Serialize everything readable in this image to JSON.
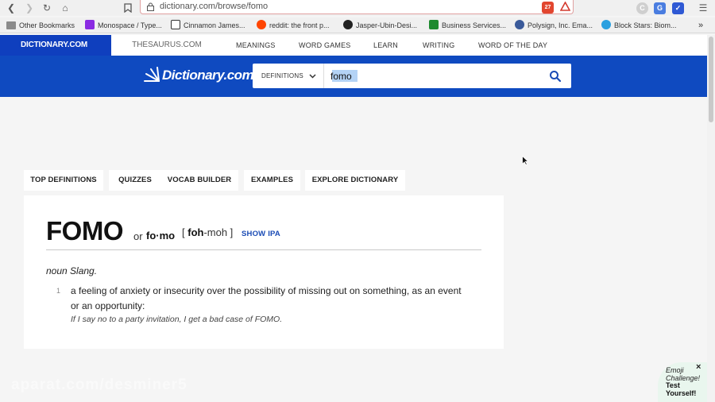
{
  "browser": {
    "url": "dictionary.com/browse/fomo",
    "extension_badge": "27",
    "bookmarks": [
      {
        "label": "Other Bookmarks",
        "icon": "folder-icon",
        "color": "#7b7b7b"
      },
      {
        "label": "Monospace / Type...",
        "icon": "monospace-favicon",
        "color": "#8a2be2"
      },
      {
        "label": "Cinnamon James...",
        "icon": "cinnamon-favicon",
        "color": "#333333"
      },
      {
        "label": "reddit: the front p...",
        "icon": "reddit-favicon",
        "color": "#ff4500"
      },
      {
        "label": "Jasper-Ubin-Desi...",
        "icon": "github-favicon",
        "color": "#222222"
      },
      {
        "label": "Business Services...",
        "icon": "business-favicon",
        "color": "#1e8a2f"
      },
      {
        "label": "Polysign, Inc. Ema...",
        "icon": "polysign-favicon",
        "color": "#3a5a9a"
      },
      {
        "label": "Block Stars: Biom...",
        "icon": "blockstars-favicon",
        "color": "#2aa0e0"
      }
    ]
  },
  "site": {
    "logo_tab": "DICTIONARY.COM",
    "thesaurus_tab": "THESAURUS.COM",
    "nav": [
      "MEANINGS",
      "WORD GAMES",
      "LEARN",
      "WRITING",
      "WORD OF THE DAY"
    ],
    "brand": "Dictionary.com",
    "brand_color": "#0f4ac0",
    "search": {
      "dropdown": "DEFINITIONS",
      "value": "fomo"
    }
  },
  "tabs": [
    "TOP DEFINITIONS",
    "QUIZZES",
    "VOCAB BUILDER",
    "EXAMPLES",
    "EXPLORE DICTIONARY"
  ],
  "entry": {
    "headword": "FOMO",
    "or": "or",
    "alt_spelling": "fo·mo",
    "pron_open": "[ ",
    "pron_stress": "foh",
    "pron_rest": "-moh ]",
    "show_ipa": "SHOW IPA",
    "pos": "noun Slang.",
    "senses": [
      {
        "num": "1",
        "definition": "a feeling of anxiety or insecurity over the possibility of missing out on something, as an event or an opportunity:",
        "example": "If I say no to a party invitation, I get a bad case of FOMO."
      }
    ]
  },
  "watermark": "aparat.com/desminer5",
  "emoji_widget": {
    "close": "×",
    "line1": "Emoji Challenge!",
    "line2": "Test Yourself!"
  }
}
